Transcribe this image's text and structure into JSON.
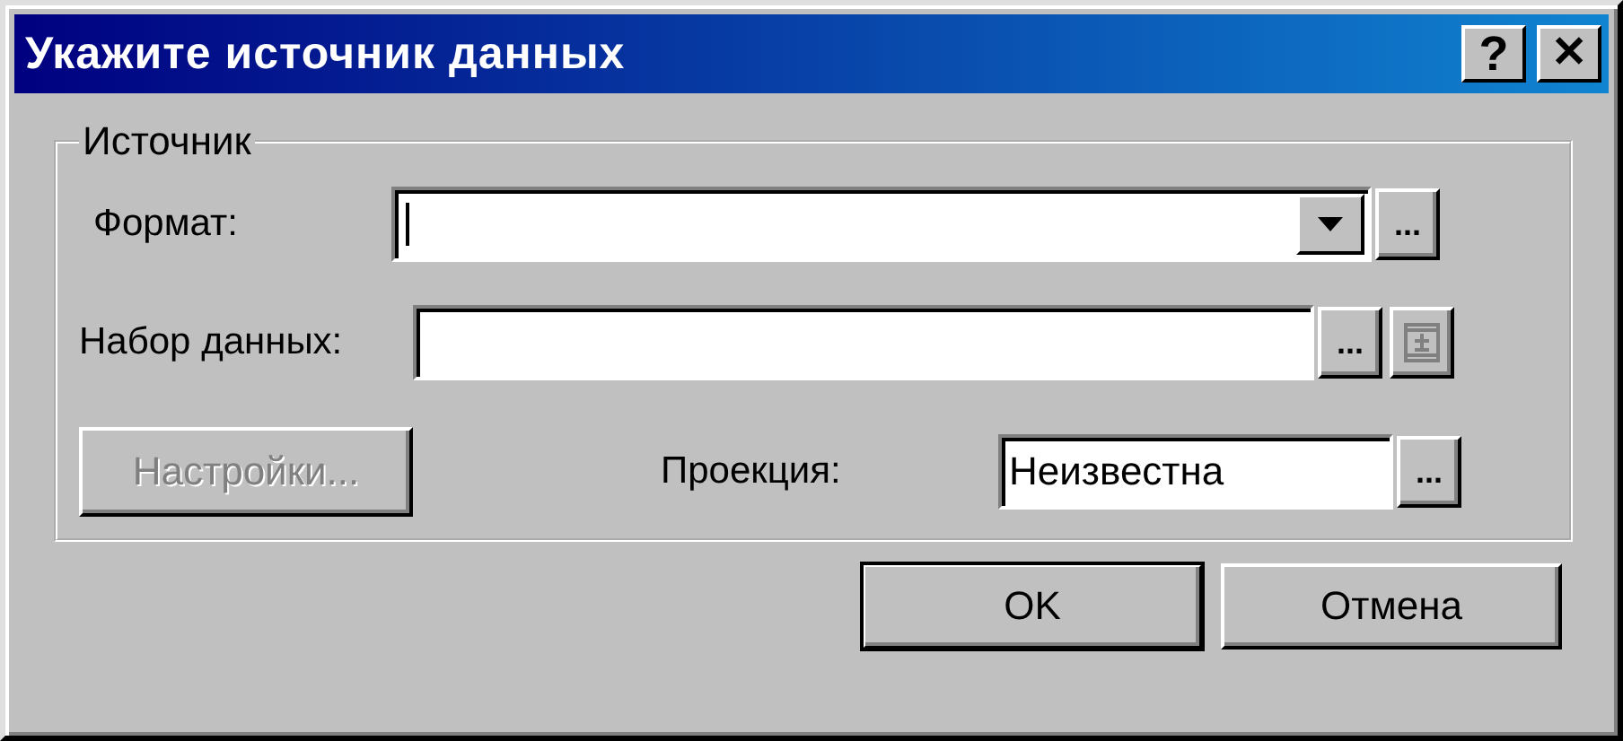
{
  "window": {
    "title": "Укажите источник данных",
    "title_buttons": [
      {
        "label": "?",
        "kind": "help"
      },
      {
        "label": "✕",
        "kind": "close"
      }
    ]
  },
  "group": {
    "label": "Источник",
    "format": {
      "label": "Формат:",
      "browse": "..."
    },
    "dataset": {
      "label": "Набор данных:",
      "browse": "...",
      "extra_disabled": true
    },
    "settings": {
      "label": "Настройки...",
      "disabled": true
    },
    "projection": {
      "label": "Проекция:",
      "value": "Неизвестна",
      "browse": "..."
    }
  },
  "buttons": [
    {
      "label": "OK",
      "default": true
    },
    {
      "label": "Отмена",
      "default": false
    }
  ]
}
